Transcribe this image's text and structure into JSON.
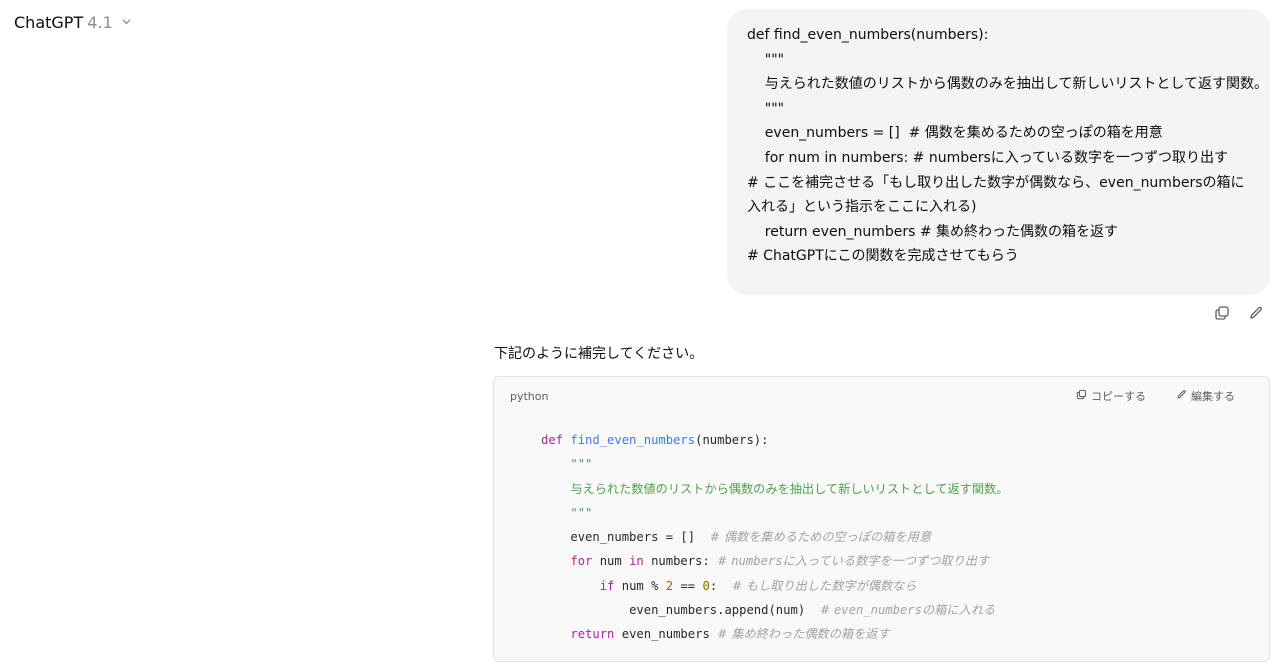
{
  "header": {
    "brand": "ChatGPT",
    "version": "4.1"
  },
  "user_message": {
    "lines": [
      "def find_even_numbers(numbers):",
      "    \"\"\"",
      "    与えられた数値のリストから偶数のみを抽出して新しいリストとして返す関数。",
      "    \"\"\"",
      "    even_numbers = []  # 偶数を集めるための空っぽの箱を用意",
      "    for num in numbers: # numbersに入っている数字を一つずつ取り出す",
      "        # ここを補完させる「もし取り出した数字が偶数なら、even_numbersの箱に入れる」という指示をここに入れる)",
      "    return even_numbers # 集め終わった偶数の箱を返す",
      "",
      "# ChatGPTにこの関数を完成させてもらう"
    ]
  },
  "assistant": {
    "intro": "下記のように補完してください。",
    "code": {
      "language": "python",
      "copy_label": "コピーする",
      "edit_label": "編集する",
      "tokens": {
        "def": "def",
        "fname": "find_even_numbers",
        "params": "(numbers):",
        "docq": "\"\"\"",
        "doc": "与えられた数値のリストから偶数のみを抽出して新しいリストとして返す関数。",
        "l5a": "even_numbers = []  ",
        "l5c": "# 偶数を集めるための空っぽの箱を用意",
        "for": "for",
        "l6b": " num ",
        "in": "in",
        "l6d": " numbers: ",
        "l6c1": "# ",
        "l6c2": "numbers",
        "l6c3": "に入っている数字を一つずつ取り出す",
        "if": "if",
        "l7b": " num % ",
        "two": "2",
        "l7c": " == ",
        "zero": "0",
        "l7d": ":  ",
        "l7cm": "# もし取り出した数字が偶数なら",
        "l8a": "even_numbers.append(num)  ",
        "l8c1": "# ",
        "l8c2": "even_numbers",
        "l8c3": "の箱に入れる",
        "return": "return",
        "l9b": " even_numbers ",
        "l9c": "# 集め終わった偶数の箱を返す"
      }
    }
  },
  "icons": [
    "chevron-down-icon",
    "copy-icon",
    "edit-icon"
  ]
}
